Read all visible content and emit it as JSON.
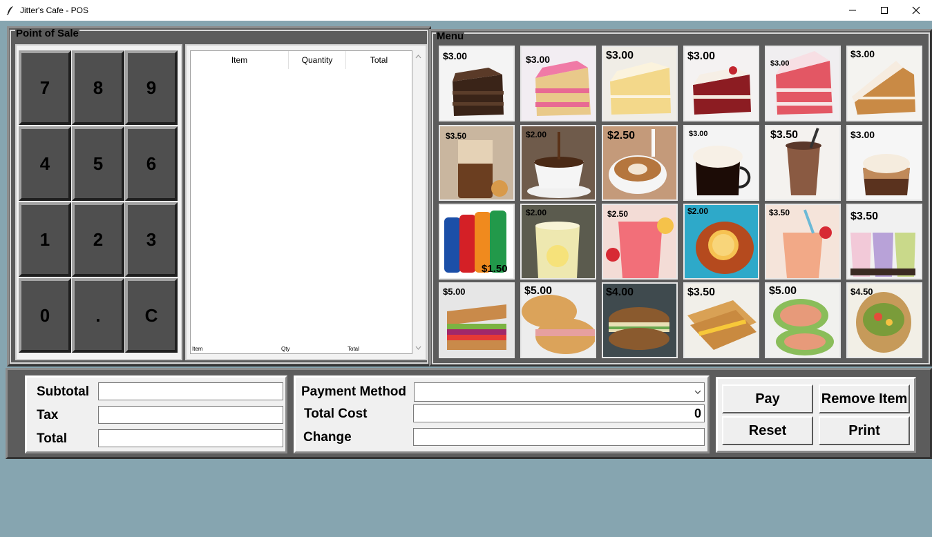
{
  "window": {
    "title": "Jitter's Cafe - POS"
  },
  "pos": {
    "label": "Point of Sale",
    "keys": [
      "7",
      "8",
      "9",
      "4",
      "5",
      "6",
      "1",
      "2",
      "3",
      "0",
      ".",
      "C"
    ],
    "list": {
      "headers": {
        "item": "Item",
        "quantity": "Quantity",
        "total": "Total"
      },
      "footer": {
        "item": "Item",
        "qty": "Qty",
        "total": "Total"
      }
    }
  },
  "menu": {
    "label": "Menu",
    "rows": [
      [
        {
          "name": "chocolate-cake",
          "price": "$3.00"
        },
        {
          "name": "strawberry-cake",
          "price": "$3.00"
        },
        {
          "name": "vanilla-cake",
          "price": "$3.00"
        },
        {
          "name": "red-velvet-cake",
          "price": "$3.00"
        },
        {
          "name": "pink-velvet-cake",
          "price": "$3.00"
        },
        {
          "name": "carrot-cake",
          "price": "$3.00"
        }
      ],
      [
        {
          "name": "iced-coffee",
          "price": "$3.50"
        },
        {
          "name": "espresso",
          "price": "$2.00"
        },
        {
          "name": "latte",
          "price": "$2.50"
        },
        {
          "name": "irish-coffee",
          "price": "$3.00"
        },
        {
          "name": "chocolate-shake",
          "price": "$3.50"
        },
        {
          "name": "mocha",
          "price": "$3.00"
        }
      ],
      [
        {
          "name": "soda-cans",
          "price": "$1.50"
        },
        {
          "name": "lemonade",
          "price": "$2.00"
        },
        {
          "name": "strawberry-lemonade",
          "price": "$2.50"
        },
        {
          "name": "iced-tea",
          "price": "$2.00"
        },
        {
          "name": "smoothie",
          "price": "$3.50"
        },
        {
          "name": "bubble-tea",
          "price": "$3.50"
        }
      ],
      [
        {
          "name": "veggie-sandwich",
          "price": "$5.00"
        },
        {
          "name": "ham-sandwich",
          "price": "$5.00"
        },
        {
          "name": "egg-salad-sandwich",
          "price": "$4.00"
        },
        {
          "name": "grilled-cheese",
          "price": "$3.50"
        },
        {
          "name": "chicken-wrap",
          "price": "$5.00"
        },
        {
          "name": "veggie-wrap",
          "price": "$4.50"
        }
      ]
    ]
  },
  "totals": {
    "subtotal_label": "Subtotal",
    "subtotal_value": "",
    "tax_label": "Tax",
    "tax_value": "",
    "total_label": "Total",
    "total_value": ""
  },
  "payment": {
    "method_label": "Payment Method",
    "method_value": "",
    "total_cost_label": "Total Cost",
    "total_cost_value": "0",
    "change_label": "Change",
    "change_value": ""
  },
  "actions": {
    "pay": "Pay",
    "remove_item": "Remove Item",
    "reset": "Reset",
    "print": "Print"
  },
  "colors": {
    "background": "#86a5b0",
    "frame": "#5c5c5c",
    "key": "#4f4f4f",
    "panel": "#f0f0f0"
  }
}
